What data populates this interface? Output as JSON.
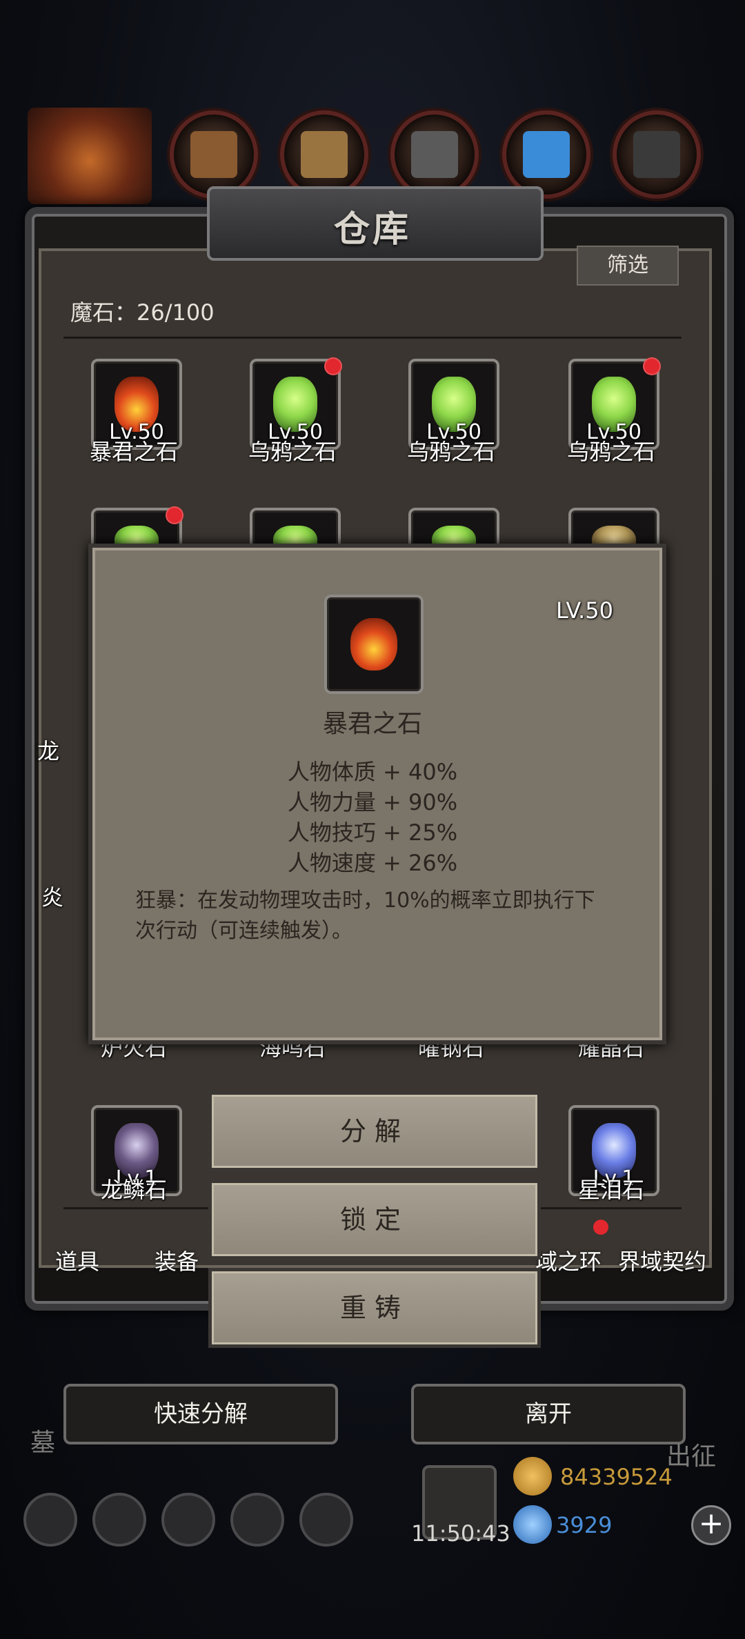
{
  "title": "仓库",
  "filter_label": "筛选",
  "count_label": "魔石：26/100",
  "grid_row1": [
    {
      "level": "Lv.50",
      "name": "暴君之石",
      "gem_color": "#e04a1c",
      "has_dot": false
    },
    {
      "level": "Lv.50",
      "name": "乌鸦之石",
      "gem_color": "#8fd84a",
      "has_dot": true
    },
    {
      "level": "Lv.50",
      "name": "乌鸦之石",
      "gem_color": "#8fd84a",
      "has_dot": false
    },
    {
      "level": "Lv.50",
      "name": "乌鸦之石",
      "gem_color": "#8fd84a",
      "has_dot": true
    }
  ],
  "grid_row2_partial": [
    {
      "gem_color": "#8fd84a",
      "has_dot": true
    },
    {
      "gem_color": "#8fd84a",
      "has_dot": false
    },
    {
      "gem_color": "#8fd84a",
      "has_dot": false
    },
    {
      "gem_color": "#b49a5a",
      "has_dot": false
    }
  ],
  "hidden_names_row3": [
    "炉火石",
    "海鸣石",
    "曜钢石",
    "耀晶石"
  ],
  "side_fragments": [
    "龙",
    "炎"
  ],
  "grid_row4": [
    {
      "level": "Lv.1",
      "name": "龙鳞石",
      "gem_color": "#6c5a86"
    },
    {
      "level": "Lv.1",
      "name": "星泪石",
      "gem_color": "#6a7ee6"
    }
  ],
  "popup": {
    "level": "LV.50",
    "name": "暴君之石",
    "stats": [
      "人物体质 + 40%",
      "人物力量 + 90%",
      "人物技巧 + 25%",
      "人物速度 + 26%"
    ],
    "description": "狂暴：在发动物理攻击时，10%的概率立即执行下次行动（可连续触发）。"
  },
  "actions": [
    "分解",
    "锁定",
    "重铸"
  ],
  "tabs": [
    "道具",
    "装备",
    "域之环",
    "界域契约"
  ],
  "quick_decompose_label": "快速分解",
  "leave_label": "离开",
  "hud": {
    "clock": "11:50:43",
    "gold": "84339524",
    "gems": "3929",
    "left_faint": "墓",
    "right_faint": "出征"
  },
  "colors": {
    "gold": "#c79a3a",
    "gems": "#4a8ed8",
    "dot": "#e3272e"
  }
}
